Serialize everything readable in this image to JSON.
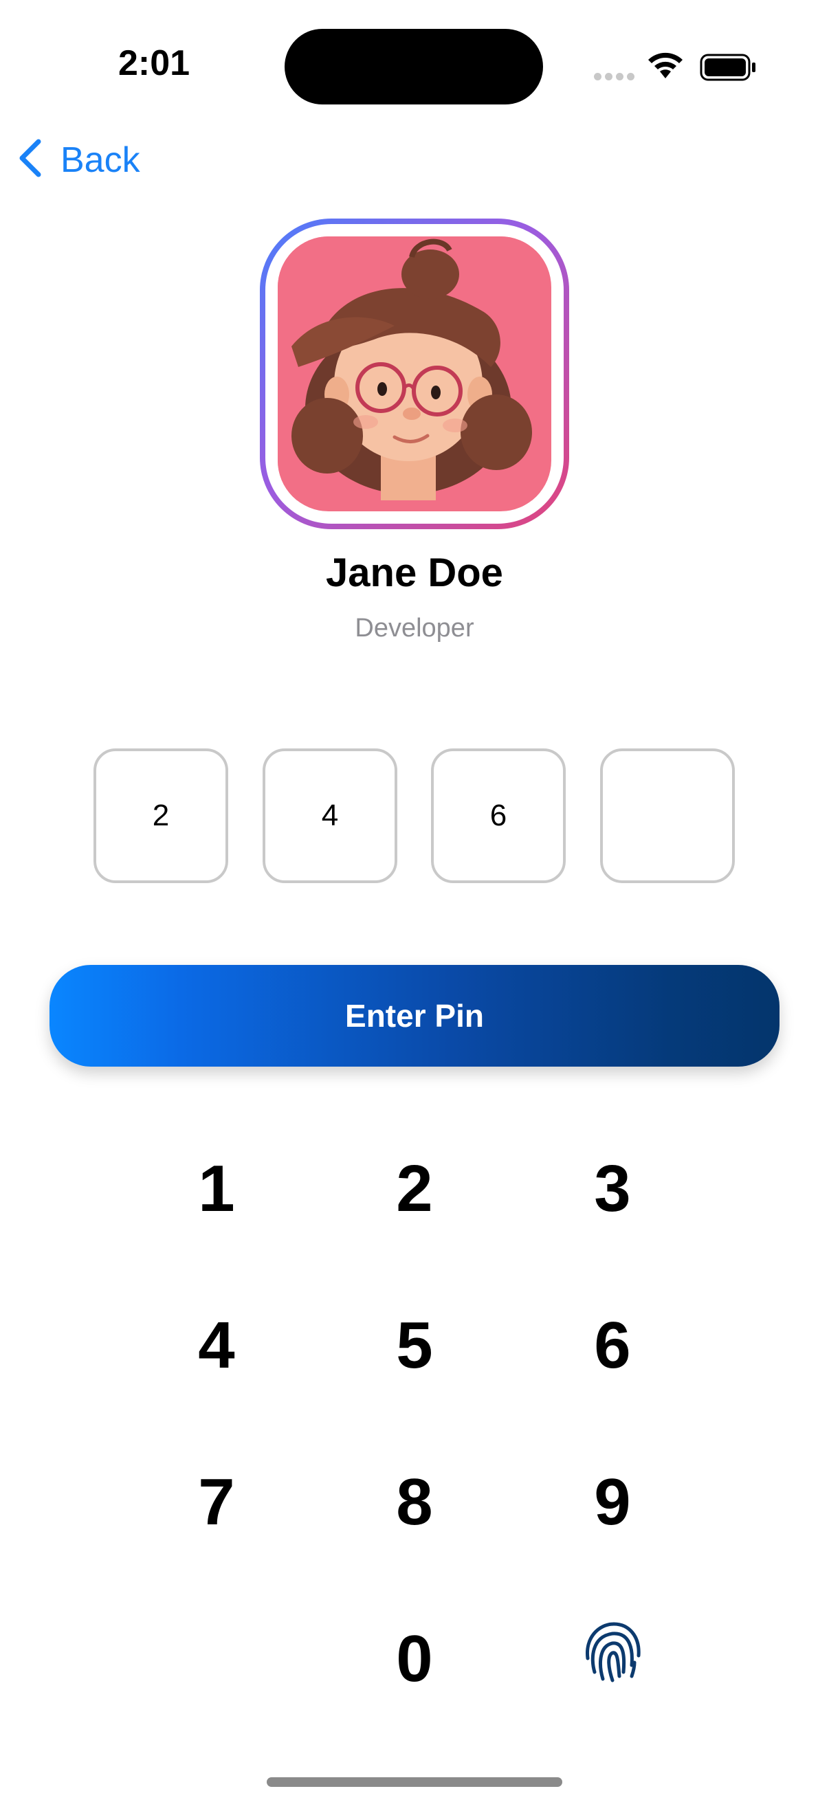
{
  "status_bar": {
    "time": "2:01"
  },
  "nav": {
    "back_label": "Back"
  },
  "profile": {
    "name": "Jane Doe",
    "role": "Developer"
  },
  "pin": {
    "digits": [
      "2",
      "4",
      "6",
      ""
    ]
  },
  "actions": {
    "enter_label": "Enter Pin"
  },
  "keypad": {
    "keys": [
      "1",
      "2",
      "3",
      "4",
      "5",
      "6",
      "7",
      "8",
      "9",
      "0"
    ],
    "biometric_icon": "fingerprint-icon"
  },
  "colors": {
    "accent": "#1a82f7",
    "button_start": "#0a86ff",
    "button_end": "#04356c",
    "avatar_background": "#f26f86",
    "fingerprint": "#0c3a6e"
  }
}
